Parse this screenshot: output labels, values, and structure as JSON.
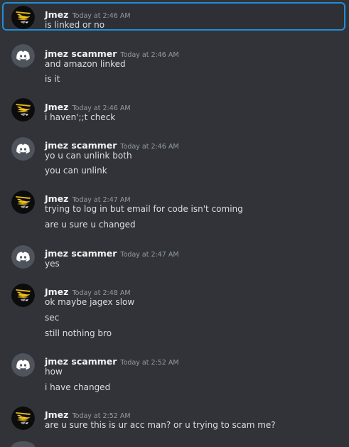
{
  "colors": {
    "background": "#313338",
    "highlight_border": "#1f8fd6",
    "author_text": "#f2f3f5",
    "message_text": "#dbdee1",
    "timestamp_text": "#949ba4",
    "discord_avatar_bg": "#4f545c"
  },
  "users": {
    "jmez": {
      "name": "Jmez",
      "avatar_icon": "jmez-logo-icon"
    },
    "scammer": {
      "name": "jmez scammer",
      "avatar_icon": "discord-logo-icon"
    }
  },
  "messages": [
    {
      "author": "Jmez",
      "time": "Today at 2:46 AM",
      "lines": [
        "is linked or no"
      ]
    },
    {
      "author": "jmez scammer",
      "time": "Today at 2:46 AM",
      "lines": [
        "and amazon linked",
        "is it"
      ]
    },
    {
      "author": "Jmez",
      "time": "Today at 2:46 AM",
      "lines": [
        "i haven';;t check"
      ]
    },
    {
      "author": "jmez scammer",
      "time": "Today at 2:46 AM",
      "lines": [
        "yo u can unlink both",
        "you can unlink"
      ]
    },
    {
      "author": "Jmez",
      "time": "Today at 2:47 AM",
      "lines": [
        "trying to log in but email for code isn't coming",
        "are u sure u changed"
      ]
    },
    {
      "author": "jmez scammer",
      "time": "Today at 2:47 AM",
      "lines": [
        "yes"
      ]
    },
    {
      "author": "Jmez",
      "time": "Today at 2:48 AM",
      "lines": [
        "ok maybe jagex slow",
        "sec",
        "still nothing bro"
      ]
    },
    {
      "author": "jmez scammer",
      "time": "Today at 2:52 AM",
      "lines": [
        "how",
        "i have changed"
      ]
    },
    {
      "author": "Jmez",
      "time": "Today at 2:52 AM",
      "lines": [
        "are u sure this is ur acc man? or u trying to scam me?"
      ]
    }
  ]
}
